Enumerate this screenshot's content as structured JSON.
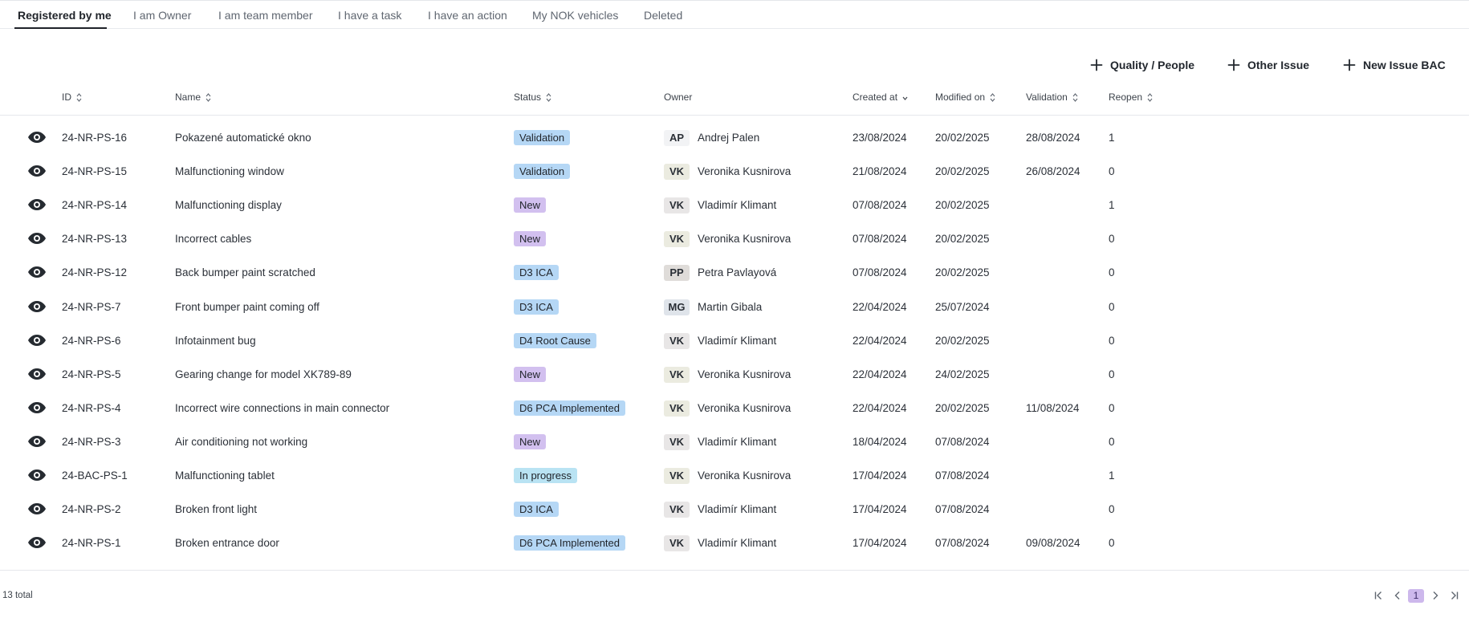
{
  "tabs": [
    {
      "label": "Registered by me",
      "active": true
    },
    {
      "label": "I am Owner"
    },
    {
      "label": "I am team member"
    },
    {
      "label": "I have a task"
    },
    {
      "label": "I have an action"
    },
    {
      "label": "My NOK vehicles"
    },
    {
      "label": "Deleted"
    }
  ],
  "actions": [
    {
      "label": "Quality / People",
      "icon": "plus-icon"
    },
    {
      "label": "Other Issue",
      "icon": "plus-icon"
    },
    {
      "label": "New Issue BAC",
      "icon": "plus-icon"
    }
  ],
  "columns": [
    {
      "label": "ID",
      "sort": "both"
    },
    {
      "label": "Name",
      "sort": "both"
    },
    {
      "label": "Status",
      "sort": "both"
    },
    {
      "label": "Owner"
    },
    {
      "label": "Created at",
      "sort": "desc"
    },
    {
      "label": "Modified on",
      "sort": "both"
    },
    {
      "label": "Validation",
      "sort": "both"
    },
    {
      "label": "Reopen",
      "sort": "both"
    }
  ],
  "rows": [
    {
      "id": "24-NR-PS-16",
      "name": "Pokazené automatické okno",
      "status": "Validation",
      "status_type": "blue",
      "initials": "AP",
      "initials_bg": "#f2f3f5",
      "owner": "Andrej Palen",
      "created": "23/08/2024",
      "modified": "20/02/2025",
      "validation": "28/08/2024",
      "reopen": "1"
    },
    {
      "id": "24-NR-PS-15",
      "name": "Malfunctioning window",
      "status": "Validation",
      "status_type": "blue",
      "initials": "VK",
      "initials_bg": "#ebebe0",
      "owner": "Veronika Kusnirova",
      "created": "21/08/2024",
      "modified": "20/02/2025",
      "validation": "26/08/2024",
      "reopen": "0"
    },
    {
      "id": "24-NR-PS-14",
      "name": "Malfunctioning display",
      "status": "New",
      "status_type": "purple",
      "initials": "VK",
      "initials_bg": "#e8e6e6",
      "owner": "Vladimír Klimant",
      "created": "07/08/2024",
      "modified": "20/02/2025",
      "validation": "",
      "reopen": "1"
    },
    {
      "id": "24-NR-PS-13",
      "name": "Incorrect cables",
      "status": "New",
      "status_type": "purple",
      "initials": "VK",
      "initials_bg": "#ebebe0",
      "owner": "Veronika Kusnirova",
      "created": "07/08/2024",
      "modified": "20/02/2025",
      "validation": "",
      "reopen": "0"
    },
    {
      "id": "24-NR-PS-12",
      "name": "Back bumper paint scratched",
      "status": "D3 ICA",
      "status_type": "blue",
      "initials": "PP",
      "initials_bg": "#dfdcd9",
      "owner": "Petra Pavlayová",
      "created": "07/08/2024",
      "modified": "20/02/2025",
      "validation": "",
      "reopen": "0"
    },
    {
      "id": "24-NR-PS-7",
      "name": "Front bumper paint coming off",
      "status": "D3 ICA",
      "status_type": "blue",
      "initials": "MG",
      "initials_bg": "#dfe4ea",
      "owner": "Martin Gibala",
      "created": "22/04/2024",
      "modified": "25/07/2024",
      "validation": "",
      "reopen": "0"
    },
    {
      "id": "24-NR-PS-6",
      "name": "Infotainment bug",
      "status": "D4 Root Cause",
      "status_type": "blue",
      "initials": "VK",
      "initials_bg": "#e8e6e6",
      "owner": "Vladimír Klimant",
      "created": "22/04/2024",
      "modified": "20/02/2025",
      "validation": "",
      "reopen": "0"
    },
    {
      "id": "24-NR-PS-5",
      "name": "Gearing change for model XK789-89",
      "status": "New",
      "status_type": "purple",
      "initials": "VK",
      "initials_bg": "#ebebe0",
      "owner": "Veronika Kusnirova",
      "created": "22/04/2024",
      "modified": "24/02/2025",
      "validation": "",
      "reopen": "0"
    },
    {
      "id": "24-NR-PS-4",
      "name": "Incorrect wire connections in main connector",
      "status": "D6 PCA Implemented",
      "status_type": "blue",
      "initials": "VK",
      "initials_bg": "#ebebe0",
      "owner": "Veronika Kusnirova",
      "created": "22/04/2024",
      "modified": "20/02/2025",
      "validation": "11/08/2024",
      "reopen": "0"
    },
    {
      "id": "24-NR-PS-3",
      "name": "Air conditioning not working",
      "status": "New",
      "status_type": "purple",
      "initials": "VK",
      "initials_bg": "#e8e6e6",
      "owner": "Vladimír Klimant",
      "created": "18/04/2024",
      "modified": "07/08/2024",
      "validation": "",
      "reopen": "0"
    },
    {
      "id": "24-BAC-PS-1",
      "name": "Malfunctioning tablet",
      "status": "In progress",
      "status_type": "cyan",
      "initials": "VK",
      "initials_bg": "#ebebe0",
      "owner": "Veronika Kusnirova",
      "created": "17/04/2024",
      "modified": "07/08/2024",
      "validation": "",
      "reopen": "1"
    },
    {
      "id": "24-NR-PS-2",
      "name": "Broken front light",
      "status": "D3 ICA",
      "status_type": "blue",
      "initials": "VK",
      "initials_bg": "#e8e6e6",
      "owner": "Vladimír Klimant",
      "created": "17/04/2024",
      "modified": "07/08/2024",
      "validation": "",
      "reopen": "0"
    },
    {
      "id": "24-NR-PS-1",
      "name": "Broken entrance door",
      "status": "D6 PCA Implemented",
      "status_type": "blue",
      "initials": "VK",
      "initials_bg": "#e8e6e6",
      "owner": "Vladimír Klimant",
      "created": "17/04/2024",
      "modified": "07/08/2024",
      "validation": "09/08/2024",
      "reopen": "0"
    }
  ],
  "status_colors": {
    "blue": "#b5d7f5",
    "purple": "#d2c0ef",
    "cyan": "#b9e3f3"
  },
  "footer": {
    "total": "13 total",
    "current_page": "1"
  }
}
